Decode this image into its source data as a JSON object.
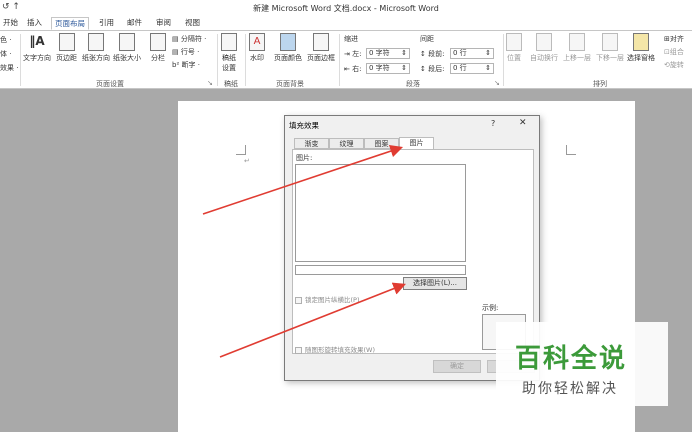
{
  "window": {
    "title": "新建 Microsoft Word 文档.docx - Microsoft Word",
    "quick_access": "↺ ↑"
  },
  "tabs": [
    {
      "label": "开始",
      "active": false
    },
    {
      "label": "插入",
      "active": false
    },
    {
      "label": "页面布局",
      "active": true
    },
    {
      "label": "引用",
      "active": false
    },
    {
      "label": "邮件",
      "active": false
    },
    {
      "label": "审阅",
      "active": false
    },
    {
      "label": "视图",
      "active": false
    }
  ],
  "ribbon": {
    "theme_items": [
      "色 ·",
      "体 ·",
      "效果 ·"
    ],
    "page_setup": {
      "text_direction": "文字方向",
      "margins": "页边距",
      "orientation": "纸张方向",
      "size": "纸张大小",
      "columns": "分栏",
      "breaks": "分隔符 ·",
      "line_numbers": "行号 ·",
      "hyphenation": "断字 ·",
      "group_label": "页面设置"
    },
    "draft": {
      "button_line1": "稿纸",
      "button_line2": "设置",
      "group_label": "稿纸"
    },
    "page_background": {
      "watermark": "水印",
      "page_color": "页面颜色",
      "page_borders": "页面边框",
      "group_label": "页面背景"
    },
    "paragraph": {
      "indent_label": "缩进",
      "left_label": "左:",
      "left_value": "0 字符",
      "right_label": "右:",
      "right_value": "0 字符",
      "spacing_label": "间距",
      "before_label": "段前:",
      "before_value": "0 行",
      "after_label": "段后:",
      "after_value": "0 行",
      "group_label": "段落"
    },
    "arrange": {
      "position": "位置",
      "wrap_text": "自动换行",
      "bring_forward": "上移一层",
      "send_backward": "下移一层",
      "selection_pane": "选择窗格",
      "align": "对齐",
      "group": "组合",
      "rotate": "旋转",
      "group_label": "排列"
    }
  },
  "dialog": {
    "title": "填充效果",
    "help": "?",
    "close": "✕",
    "tabs": [
      {
        "label": "渐变",
        "active": false
      },
      {
        "label": "纹理",
        "active": false
      },
      {
        "label": "图案",
        "active": false
      },
      {
        "label": "图片",
        "active": true
      }
    ],
    "picture_label": "图片:",
    "select_picture_button": "选择图片(L)...",
    "lock_aspect_checkbox": "锁定图片纵横比(P)",
    "rotate_with_shape_checkbox": "随图形旋转填充效果(W)",
    "sample_label": "示例:",
    "ok_button": "确定"
  },
  "colors": {
    "arrow": "#e03c32",
    "watermark_green": "#3c9a3a",
    "accent": "#2b579a"
  },
  "watermark": {
    "title": "百科全说",
    "subtitle": "助你轻松解决"
  }
}
